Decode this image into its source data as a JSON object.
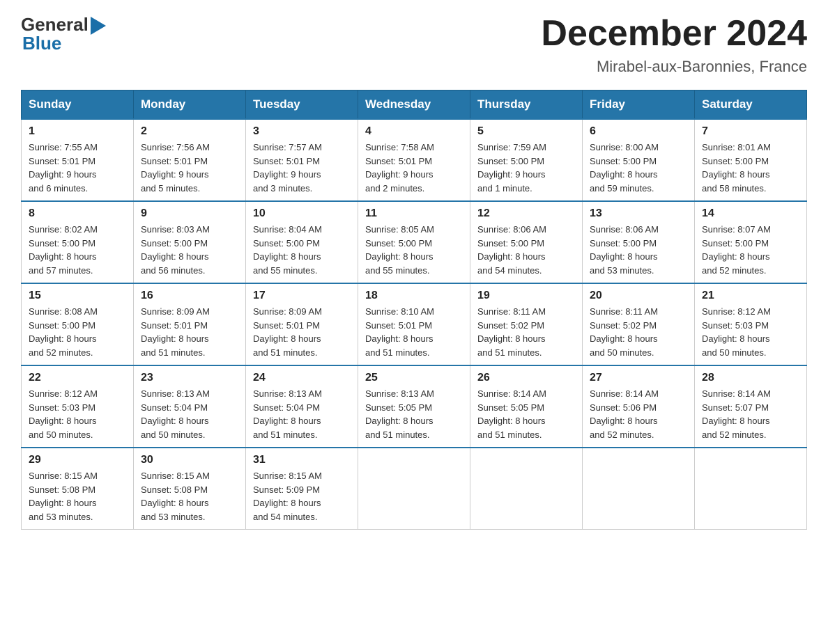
{
  "header": {
    "logo_general": "General",
    "logo_blue": "Blue",
    "month_title": "December 2024",
    "location": "Mirabel-aux-Baronnies, France"
  },
  "days_of_week": [
    "Sunday",
    "Monday",
    "Tuesday",
    "Wednesday",
    "Thursday",
    "Friday",
    "Saturday"
  ],
  "weeks": [
    [
      {
        "day": "1",
        "info": "Sunrise: 7:55 AM\nSunset: 5:01 PM\nDaylight: 9 hours\nand 6 minutes."
      },
      {
        "day": "2",
        "info": "Sunrise: 7:56 AM\nSunset: 5:01 PM\nDaylight: 9 hours\nand 5 minutes."
      },
      {
        "day": "3",
        "info": "Sunrise: 7:57 AM\nSunset: 5:01 PM\nDaylight: 9 hours\nand 3 minutes."
      },
      {
        "day": "4",
        "info": "Sunrise: 7:58 AM\nSunset: 5:01 PM\nDaylight: 9 hours\nand 2 minutes."
      },
      {
        "day": "5",
        "info": "Sunrise: 7:59 AM\nSunset: 5:00 PM\nDaylight: 9 hours\nand 1 minute."
      },
      {
        "day": "6",
        "info": "Sunrise: 8:00 AM\nSunset: 5:00 PM\nDaylight: 8 hours\nand 59 minutes."
      },
      {
        "day": "7",
        "info": "Sunrise: 8:01 AM\nSunset: 5:00 PM\nDaylight: 8 hours\nand 58 minutes."
      }
    ],
    [
      {
        "day": "8",
        "info": "Sunrise: 8:02 AM\nSunset: 5:00 PM\nDaylight: 8 hours\nand 57 minutes."
      },
      {
        "day": "9",
        "info": "Sunrise: 8:03 AM\nSunset: 5:00 PM\nDaylight: 8 hours\nand 56 minutes."
      },
      {
        "day": "10",
        "info": "Sunrise: 8:04 AM\nSunset: 5:00 PM\nDaylight: 8 hours\nand 55 minutes."
      },
      {
        "day": "11",
        "info": "Sunrise: 8:05 AM\nSunset: 5:00 PM\nDaylight: 8 hours\nand 55 minutes."
      },
      {
        "day": "12",
        "info": "Sunrise: 8:06 AM\nSunset: 5:00 PM\nDaylight: 8 hours\nand 54 minutes."
      },
      {
        "day": "13",
        "info": "Sunrise: 8:06 AM\nSunset: 5:00 PM\nDaylight: 8 hours\nand 53 minutes."
      },
      {
        "day": "14",
        "info": "Sunrise: 8:07 AM\nSunset: 5:00 PM\nDaylight: 8 hours\nand 52 minutes."
      }
    ],
    [
      {
        "day": "15",
        "info": "Sunrise: 8:08 AM\nSunset: 5:00 PM\nDaylight: 8 hours\nand 52 minutes."
      },
      {
        "day": "16",
        "info": "Sunrise: 8:09 AM\nSunset: 5:01 PM\nDaylight: 8 hours\nand 51 minutes."
      },
      {
        "day": "17",
        "info": "Sunrise: 8:09 AM\nSunset: 5:01 PM\nDaylight: 8 hours\nand 51 minutes."
      },
      {
        "day": "18",
        "info": "Sunrise: 8:10 AM\nSunset: 5:01 PM\nDaylight: 8 hours\nand 51 minutes."
      },
      {
        "day": "19",
        "info": "Sunrise: 8:11 AM\nSunset: 5:02 PM\nDaylight: 8 hours\nand 51 minutes."
      },
      {
        "day": "20",
        "info": "Sunrise: 8:11 AM\nSunset: 5:02 PM\nDaylight: 8 hours\nand 50 minutes."
      },
      {
        "day": "21",
        "info": "Sunrise: 8:12 AM\nSunset: 5:03 PM\nDaylight: 8 hours\nand 50 minutes."
      }
    ],
    [
      {
        "day": "22",
        "info": "Sunrise: 8:12 AM\nSunset: 5:03 PM\nDaylight: 8 hours\nand 50 minutes."
      },
      {
        "day": "23",
        "info": "Sunrise: 8:13 AM\nSunset: 5:04 PM\nDaylight: 8 hours\nand 50 minutes."
      },
      {
        "day": "24",
        "info": "Sunrise: 8:13 AM\nSunset: 5:04 PM\nDaylight: 8 hours\nand 51 minutes."
      },
      {
        "day": "25",
        "info": "Sunrise: 8:13 AM\nSunset: 5:05 PM\nDaylight: 8 hours\nand 51 minutes."
      },
      {
        "day": "26",
        "info": "Sunrise: 8:14 AM\nSunset: 5:05 PM\nDaylight: 8 hours\nand 51 minutes."
      },
      {
        "day": "27",
        "info": "Sunrise: 8:14 AM\nSunset: 5:06 PM\nDaylight: 8 hours\nand 52 minutes."
      },
      {
        "day": "28",
        "info": "Sunrise: 8:14 AM\nSunset: 5:07 PM\nDaylight: 8 hours\nand 52 minutes."
      }
    ],
    [
      {
        "day": "29",
        "info": "Sunrise: 8:15 AM\nSunset: 5:08 PM\nDaylight: 8 hours\nand 53 minutes."
      },
      {
        "day": "30",
        "info": "Sunrise: 8:15 AM\nSunset: 5:08 PM\nDaylight: 8 hours\nand 53 minutes."
      },
      {
        "day": "31",
        "info": "Sunrise: 8:15 AM\nSunset: 5:09 PM\nDaylight: 8 hours\nand 54 minutes."
      },
      {
        "day": "",
        "info": ""
      },
      {
        "day": "",
        "info": ""
      },
      {
        "day": "",
        "info": ""
      },
      {
        "day": "",
        "info": ""
      }
    ]
  ]
}
